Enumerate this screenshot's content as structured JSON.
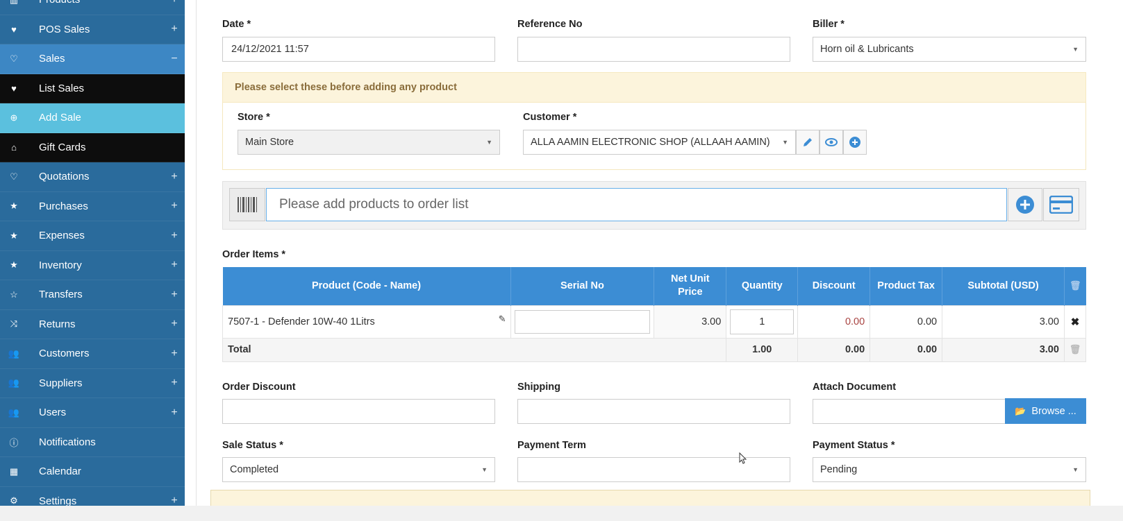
{
  "sidebar": {
    "items": [
      {
        "label": "Products",
        "icon": "barcode-icon",
        "toggle": "+",
        "state": "normal"
      },
      {
        "label": "POS Sales",
        "icon": "heart-icon",
        "toggle": "+",
        "state": "normal"
      },
      {
        "label": "Sales",
        "icon": "heart-outline-icon",
        "toggle": "−",
        "state": "active"
      },
      {
        "label": "List Sales",
        "icon": "heart-icon",
        "toggle": "",
        "state": "sub"
      },
      {
        "label": "Add Sale",
        "icon": "plus-circle-icon",
        "toggle": "",
        "state": "sub-active"
      },
      {
        "label": "Gift Cards",
        "icon": "gift-icon",
        "toggle": "",
        "state": "sub"
      },
      {
        "label": "Quotations",
        "icon": "heart-outline-icon",
        "toggle": "+",
        "state": "normal"
      },
      {
        "label": "Purchases",
        "icon": "star-icon",
        "toggle": "+",
        "state": "normal"
      },
      {
        "label": "Expenses",
        "icon": "star-icon",
        "toggle": "+",
        "state": "normal"
      },
      {
        "label": "Inventory",
        "icon": "star-icon",
        "toggle": "+",
        "state": "normal"
      },
      {
        "label": "Transfers",
        "icon": "star-outline-icon",
        "toggle": "+",
        "state": "normal"
      },
      {
        "label": "Returns",
        "icon": "random-icon",
        "toggle": "+",
        "state": "normal"
      },
      {
        "label": "Customers",
        "icon": "users-icon",
        "toggle": "+",
        "state": "normal"
      },
      {
        "label": "Suppliers",
        "icon": "users-icon",
        "toggle": "+",
        "state": "normal"
      },
      {
        "label": "Users",
        "icon": "users-icon",
        "toggle": "+",
        "state": "normal"
      },
      {
        "label": "Notifications",
        "icon": "info-icon",
        "toggle": "",
        "state": "normal"
      },
      {
        "label": "Calendar",
        "icon": "calendar-icon",
        "toggle": "",
        "state": "normal"
      },
      {
        "label": "Settings",
        "icon": "gear-icon",
        "toggle": "+",
        "state": "normal"
      }
    ]
  },
  "form": {
    "date_label": "Date *",
    "date_value": "24/12/2021 11:57",
    "reference_label": "Reference No",
    "reference_value": "",
    "biller_label": "Biller *",
    "biller_value": "Horn oil & Lubricants",
    "notice": "Please select these before adding any product",
    "store_label": "Store *",
    "store_value": "Main Store",
    "customer_label": "Customer *",
    "customer_value": "ALLA AAMIN ELECTRONIC SHOP (ALLAAH AAMIN)",
    "search_placeholder": "Please add products to order list",
    "order_items_label": "Order Items *"
  },
  "table": {
    "headers": [
      "Product (Code - Name)",
      "Serial No",
      "Net Unit Price",
      "Quantity",
      "Discount",
      "Product Tax",
      "Subtotal (USD)"
    ],
    "rows": [
      {
        "product": "7507-1 - Defender 10W-40 1Litrs",
        "serial": "",
        "price": "3.00",
        "quantity": "1",
        "discount": "0.00",
        "tax": "0.00",
        "subtotal": "3.00"
      }
    ],
    "total": {
      "label": "Total",
      "quantity": "1.00",
      "discount": "0.00",
      "tax": "0.00",
      "subtotal": "3.00"
    }
  },
  "lower": {
    "order_discount_label": "Order Discount",
    "order_discount_value": "",
    "shipping_label": "Shipping",
    "shipping_value": "",
    "attach_label": "Attach Document",
    "browse_label": "Browse ...",
    "sale_status_label": "Sale Status *",
    "sale_status_value": "Completed",
    "payment_term_label": "Payment Term",
    "payment_term_value": "",
    "payment_status_label": "Payment Status *",
    "payment_status_value": "Pending"
  },
  "colors": {
    "sidebar": "#2a6b9c",
    "sidebar_active": "#3d87c4",
    "submenu": "#0d0d0d",
    "submenu_active": "#5bc0de",
    "primary": "#3c8dd4",
    "notice_bg": "#fcf4dc",
    "discount_red": "#a94442"
  }
}
